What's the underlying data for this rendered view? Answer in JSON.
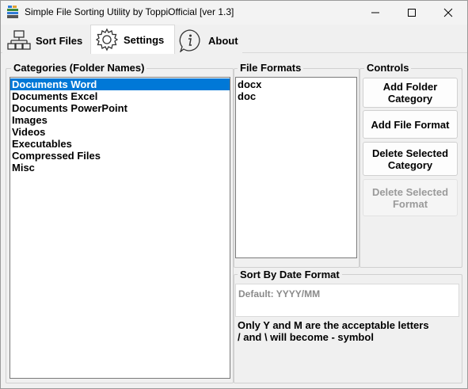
{
  "window": {
    "title": "Simple File Sorting Utility by ToppiOfficial [ver 1.3]",
    "controls": {
      "minimize_icon": "minimize-icon",
      "maximize_icon": "maximize-icon",
      "close_icon": "close-icon"
    }
  },
  "tabs": [
    {
      "label": "Sort Files",
      "icon": "sort-files-icon",
      "active": false
    },
    {
      "label": "Settings",
      "icon": "gear-icon",
      "active": true
    },
    {
      "label": "About",
      "icon": "info-icon",
      "active": false
    }
  ],
  "settings": {
    "categories": {
      "label": "Categories (Folder Names)",
      "items": [
        "Documents Word",
        "Documents Excel",
        "Documents PowerPoint",
        "Images",
        "Videos",
        "Executables",
        "Compressed Files",
        "Misc"
      ],
      "selected": "Documents Word"
    },
    "file_formats": {
      "label": "File Formats",
      "items": [
        "docx",
        "doc"
      ]
    },
    "controls": {
      "label": "Controls",
      "buttons": {
        "add_folder_category": "Add Folder Category",
        "add_file_format": "Add File Format",
        "delete_selected_category": "Delete Selected Category",
        "delete_selected_format": "Delete Selected Format"
      }
    },
    "date_format": {
      "label": "Sort By Date Format",
      "placeholder": "Default:  YYYY/MM",
      "note_line1": "Only Y and M are the acceptable letters",
      "note_line2": "/ and \\ will become - symbol"
    }
  },
  "colors": {
    "selection": "#0078d7",
    "window_bg": "#f0f0f0",
    "disabled_text": "#9a9a9a"
  }
}
